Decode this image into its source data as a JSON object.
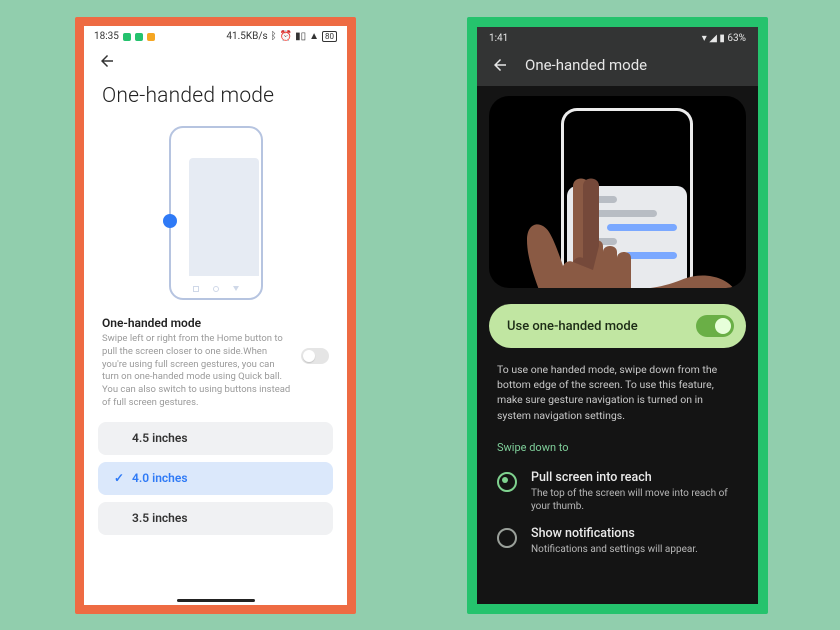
{
  "left": {
    "status": {
      "time": "18:35",
      "net": "41.5KB/s"
    },
    "title": "One-handed mode",
    "section_title": "One-handed mode",
    "section_desc": "Swipe left or right from the Home button to pull the screen closer to one side.When you're using full screen gestures, you can turn on one-handed mode using Quick ball. You can also switch to using buttons instead of full screen gestures.",
    "options": [
      {
        "label": "4.5 inches",
        "selected": false
      },
      {
        "label": "4.0 inches",
        "selected": true
      },
      {
        "label": "3.5 inches",
        "selected": false
      }
    ]
  },
  "right": {
    "status": {
      "time": "1:41",
      "battery": "63%"
    },
    "title": "One-handed mode",
    "toggle_label": "Use one-handed mode",
    "help": "To use one handed mode, swipe down from the bottom edge of the screen. To use this feature, make sure gesture navigation is turned on in system navigation settings.",
    "section": "Swipe down to",
    "radios": [
      {
        "title": "Pull screen into reach",
        "desc": "The top of the screen will move into reach of your thumb.",
        "on": true
      },
      {
        "title": "Show notifications",
        "desc": "Notifications and settings will appear.",
        "on": false
      }
    ]
  }
}
